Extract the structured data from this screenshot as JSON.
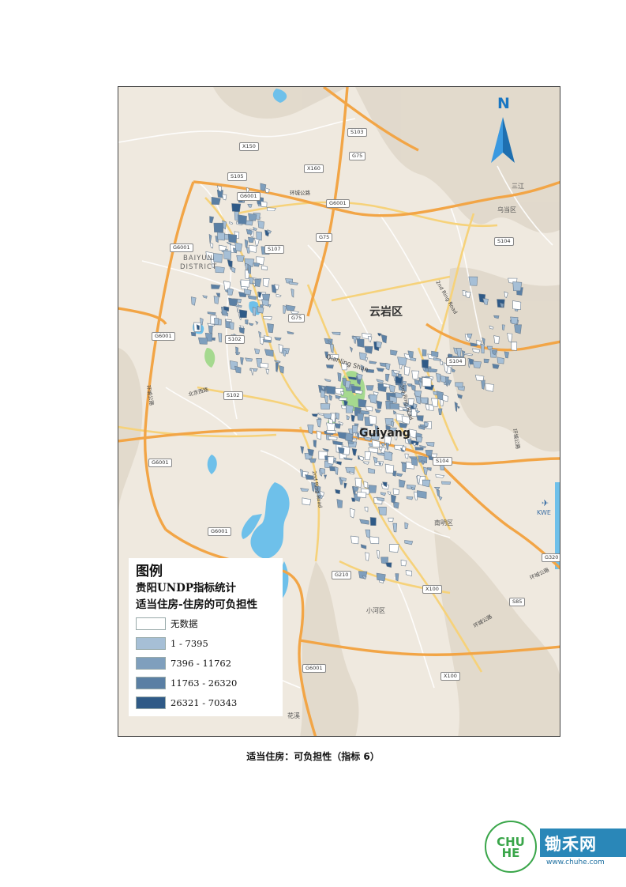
{
  "map": {
    "north_label": "N",
    "place_labels": {
      "yunyan": "云岩区",
      "guiyang": "Guiyang",
      "baiyun": "BAIYUN",
      "baiyun_district": "DISTRICT",
      "qianling": "Qianling Shan",
      "nanming": "南明区",
      "xiaohe": "小河区",
      "wudang": "乌当区",
      "sanjiang": "三江",
      "kwe": "KWE",
      "huaxi": "花溪"
    },
    "road_labels": {
      "s103": "S103",
      "x150": "X150",
      "g75a": "G75",
      "x160": "X160",
      "s105": "S105",
      "g6001a": "G6001",
      "huancheng_n": "环城公路",
      "g6001b": "G6001",
      "s107": "S107",
      "g75b": "G75",
      "g6001c": "G6001",
      "g75c": "G75",
      "g6001d": "G6001",
      "s102a": "S102",
      "s102b": "S102",
      "beijing_w": "北京西路",
      "s104a": "S104",
      "s104b": "S104",
      "s104c": "S104",
      "second_ring_n": "2nd Ring Road",
      "second_ring_s": "2nd Ring Road",
      "third_ring": "3rd Ring Road",
      "g6001e": "G6001",
      "g6001f": "G6001",
      "g6001g": "G6001",
      "g210": "G210",
      "x100a": "X100",
      "x100b": "X100",
      "s85": "S85",
      "g320": "G320",
      "huancheng_w": "环城公路",
      "huancheng_e": "环城公路",
      "huancheng_se": "环城公路",
      "huancheng_s": "环城公路"
    },
    "colors": {
      "land": "#efe9df",
      "terrain": "#ddd4c6",
      "water": "#6ec0ea",
      "park": "#a5d98f",
      "highway": "#f2a546",
      "major_road": "#f6d27a",
      "road": "#ffffff"
    }
  },
  "legend": {
    "title": "图例",
    "subtitle1": "贵阳UNDP指标统计",
    "subtitle2": "适当住房-住房的可负担性",
    "items": [
      {
        "label": "无数据",
        "color": "#ffffff"
      },
      {
        "label": "1 - 7395",
        "color": "#a6bfd6"
      },
      {
        "label": "7396 - 11762",
        "color": "#7f9fbd"
      },
      {
        "label": "11763 - 26320",
        "color": "#5a7fa4"
      },
      {
        "label": "26321 - 70343",
        "color": "#2f5a87"
      }
    ]
  },
  "caption": "适当住房：可负担性（指标 6）",
  "logo": {
    "mark_text": "CHU HE",
    "name": "锄禾网",
    "url": "www.chuhe.com"
  }
}
